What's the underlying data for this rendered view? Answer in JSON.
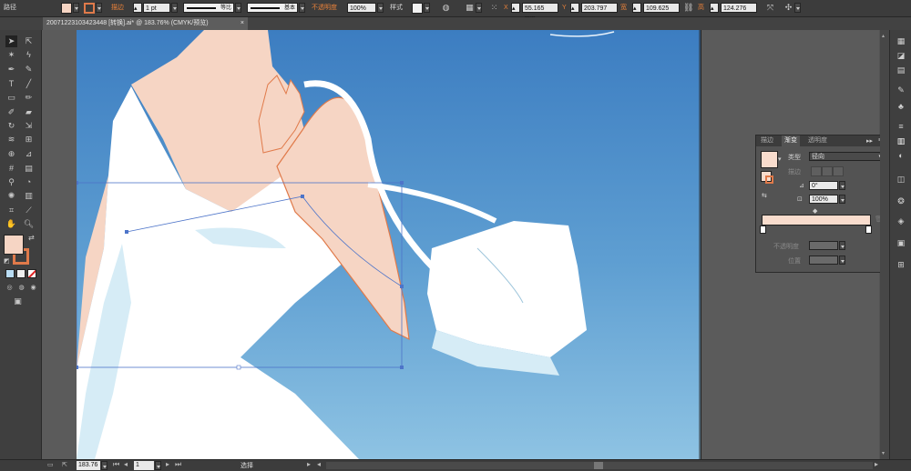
{
  "control_bar": {
    "object_type": "路径",
    "stroke_label": "描边",
    "stroke_weight": "1 pt",
    "profile_label": "等比",
    "brush_label": "基本",
    "opacity_label": "不透明度",
    "opacity_value": "100%",
    "style_label": "样式",
    "x_label": "X",
    "x_value": "55.165 mm",
    "y_label": "Y",
    "y_value": "203.797",
    "w_label": "宽",
    "w_value": "109.625",
    "h_label": "高",
    "h_value": "124.276",
    "fill_color": "#f6d5c4",
    "stroke_color": "#e07a4a"
  },
  "document_tab": {
    "title": "20071223103423448 [转换].ai* @ 183.76% (CMYK/预览)",
    "close": "×"
  },
  "status_bar": {
    "zoom": "183.76",
    "page": "1",
    "tool_status": "选择"
  },
  "gradient_panel": {
    "tabs": [
      "描边",
      "渐变",
      "透明度"
    ],
    "active_tab": "渐变",
    "type_label": "类型",
    "type_value": "径向",
    "stroke_label": "描边",
    "angle_value": "0°",
    "aspect_value": "100%",
    "opacity_label": "不透明度",
    "location_label": "位置",
    "gradient_start": "#f8dccd",
    "gradient_end": "#f8dccd"
  },
  "tool_colors": {
    "fill": "#f6d5c4",
    "stroke": "#e07a4a"
  },
  "icons": [
    "selection-tool-icon",
    "direct-selection-tool-icon",
    "magic-wand-icon",
    "lasso-icon",
    "pen-tool-icon",
    "type-tool-icon",
    "line-tool-icon",
    "rectangle-tool-icon",
    "paintbrush-icon",
    "pencil-icon",
    "rotate-icon",
    "scale-icon",
    "hand-tool-icon",
    "zoom-tool-icon"
  ]
}
